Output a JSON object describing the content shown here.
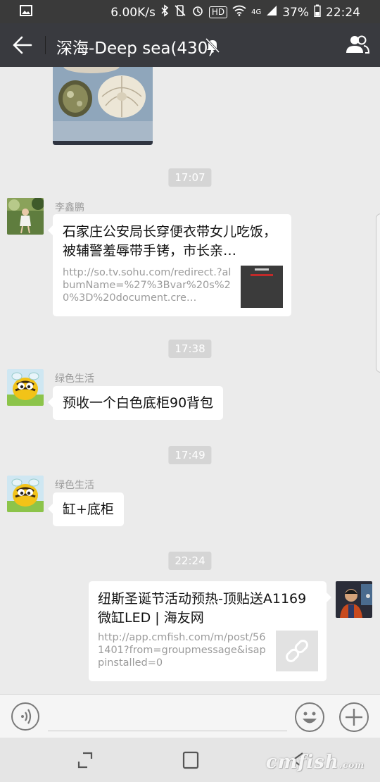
{
  "status_bar": {
    "speed": "6.00K/s",
    "hd": "HD",
    "network": "4G",
    "battery": "37%",
    "time": "22:24"
  },
  "header": {
    "title": "深海-Deep sea(430)"
  },
  "messages": {
    "t1": "17:07",
    "m1": {
      "sender": "李鑫鹏",
      "link_title": "石家庄公安局长穿便衣带女儿吃饭，被辅警羞辱带手铐，市长亲…",
      "link_desc": "http://so.tv.sohu.com/redirect.?albumName=%27%3Bvar%20s%20%3D%20document.cre…"
    },
    "t2": "17:38",
    "m2": {
      "sender": "绿色生活",
      "text": "预收一个白色底柜90背包"
    },
    "t3": "17:49",
    "m3": {
      "sender": "绿色生活",
      "text": "缸+底柜"
    },
    "t4": "22:24",
    "m4": {
      "link_title": "纽斯圣诞节活动预热-顶贴送A1169微缸LED | 海友网",
      "link_desc": "http://app.cmfish.com/m/post/561401?from=groupmessage&isappinstalled=0"
    }
  },
  "input": {
    "placeholder": ""
  },
  "watermark": "cmfish",
  "watermark_suffix": ".com",
  "colors": {
    "title_bar": "#393a3f",
    "status_bar": "#3a3a3a",
    "chat_bg": "#ebebeb",
    "time_badge": "#d5d5d5"
  }
}
